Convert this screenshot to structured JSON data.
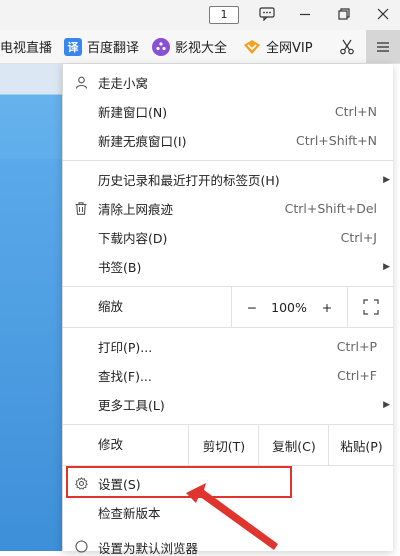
{
  "titlebar": {
    "counter": "1",
    "buttons": [
      "chat-icon",
      "minimize-icon",
      "restore-icon",
      "close-icon"
    ]
  },
  "bookmarks": {
    "items": [
      {
        "label": "电视直播",
        "icon": "tv-icon"
      },
      {
        "label": "百度翻译",
        "icon": "translate-icon",
        "icon_text": "译",
        "color": "#3a86f0"
      },
      {
        "label": "影视大全",
        "icon": "film-icon",
        "color": "#8a4fd6"
      },
      {
        "label": "全网VIP",
        "icon": "vip-icon",
        "color": "#f4a020"
      }
    ]
  },
  "menu": {
    "items": [
      {
        "label": "走走小窝",
        "icon": "user-icon"
      },
      {
        "label": "新建窗口(N)",
        "shortcut": "Ctrl+N"
      },
      {
        "label": "新建无痕窗口(I)",
        "shortcut": "Ctrl+Shift+N"
      },
      {
        "label": "历史记录和最近打开的标签页(H)",
        "submenu": true
      },
      {
        "label": "清除上网痕迹",
        "shortcut": "Ctrl+Shift+Del",
        "icon": "trash-icon"
      },
      {
        "label": "下载内容(D)",
        "shortcut": "Ctrl+J"
      },
      {
        "label": "书签(B)",
        "submenu": true
      },
      {
        "label": "打印(P)...",
        "shortcut": "Ctrl+P"
      },
      {
        "label": "查找(F)...",
        "shortcut": "Ctrl+F"
      },
      {
        "label": "更多工具(L)",
        "submenu": true
      },
      {
        "label": "设置(S)",
        "icon": "gear-icon"
      },
      {
        "label": "检查新版本"
      },
      {
        "label": "设置为默认浏览器"
      }
    ],
    "zoom": {
      "label": "缩放",
      "minus": "−",
      "value": "100%",
      "plus": "+",
      "fullscreen_icon": "fullscreen-icon"
    },
    "edit": {
      "label": "修改",
      "cut": "剪切(T)",
      "copy": "复制(C)",
      "paste": "粘贴(P)"
    }
  },
  "annotation": {
    "highlight_color": "#e0342e"
  }
}
